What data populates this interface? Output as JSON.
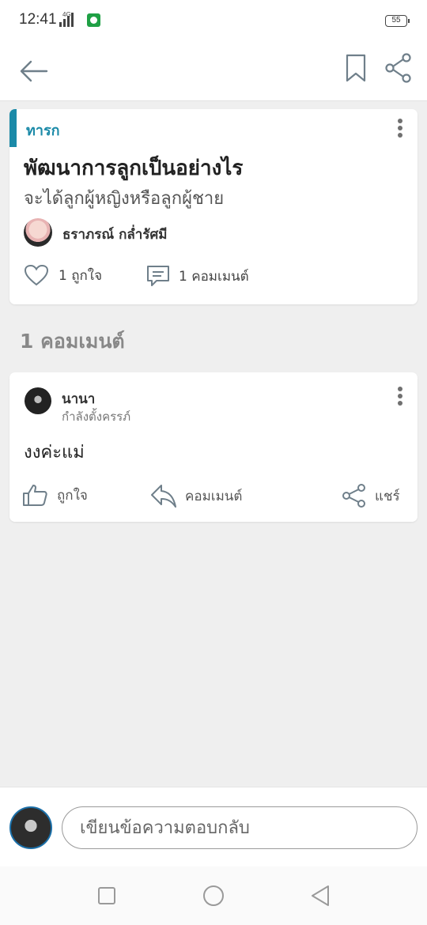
{
  "status_bar": {
    "time": "12:41",
    "network": "4G",
    "battery": "55"
  },
  "toolbar": {
    "back_icon": "arrow-left-icon",
    "bookmark_icon": "bookmark-icon",
    "share_icon": "share-icon"
  },
  "post": {
    "category": "ทารก",
    "title": "พัฒนาการลูกเป็นอย่างไร",
    "subtitle": "จะได้ลูกผู้หญิงหรือลูกผู้ชาย",
    "author": "ธราภรณ์ กล่ำรัศมี",
    "likes_label": "1 ถูกใจ",
    "comments_label": "1 คอมเมนต์"
  },
  "comments_section": {
    "title": "1 คอมเมนต์"
  },
  "comments": [
    {
      "name": "นานา",
      "status": "กำลังตั้งครรภ์",
      "body": "งงค่ะแม่",
      "like_label": "ถูกใจ",
      "reply_label": "คอมเมนต์",
      "share_label": "แชร์"
    }
  ],
  "reply": {
    "placeholder": "เขียนข้อความตอบกลับ"
  },
  "colors": {
    "accent": "#1b8aa8",
    "background": "#efefef",
    "card": "#ffffff"
  }
}
